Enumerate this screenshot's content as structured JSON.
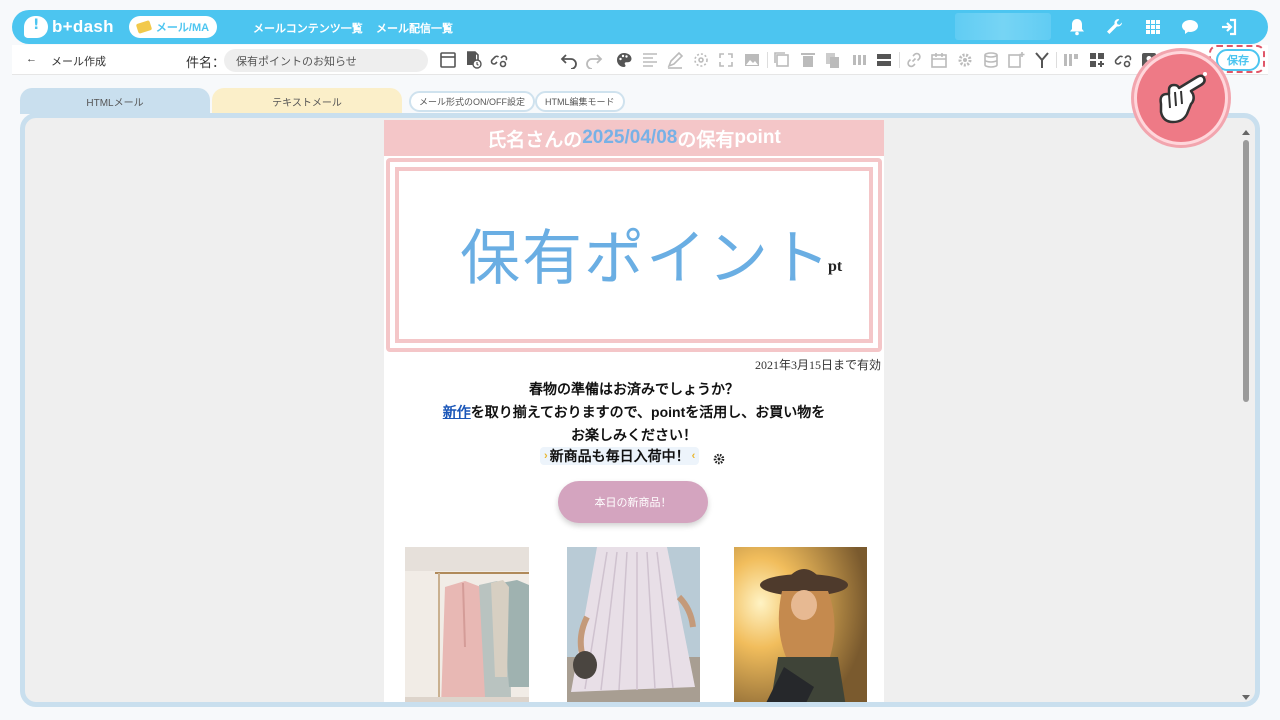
{
  "app": {
    "logo_text": "b+dash",
    "nav_pill": "メール/MA",
    "nav_links": [
      "メールコンテンツ一覧",
      "メール配信一覧"
    ],
    "accent_color": "#4cc5f0"
  },
  "subbar": {
    "back_label": "←",
    "page_title": "メール作成",
    "subject_label": "件名：",
    "subject_value": "保有ポイントのお知らせ",
    "save_label": "保存"
  },
  "tabs": {
    "html_mail": "HTMLメール",
    "text_mail": "テキストメール",
    "format_toggle": "メール形式のON/OFF設定",
    "html_edit_mode": "HTML編集モード"
  },
  "email": {
    "header_prefix": "氏名さんの",
    "header_date": "2025/04/08",
    "header_mid": "の保有",
    "header_suffix": "point",
    "points_title": "保有ポイント",
    "points_unit": "pt",
    "valid_until": "2021年3月15日まで有効",
    "line1": "春物の準備はお済みでしょうか？",
    "line2_link": "新作",
    "line2_rest": "を取り揃えておりますので、pointを活用し、お買い物を",
    "line3": "お楽しみください！",
    "line4": "新商品も毎日入荷中！",
    "cta_label": "本日の新商品！",
    "header_color": "#f4c6c8",
    "highlight_color": "#78b1e6",
    "cta_color": "#d4a4bf"
  },
  "icons": {
    "top": [
      "bell-icon",
      "wrench-icon",
      "grid-icon",
      "chat-icon",
      "logout-icon"
    ],
    "toolbar": [
      "preview-icon",
      "schedule-icon",
      "link-check-icon",
      "undo-icon",
      "redo-icon",
      "palette-icon",
      "align-icon",
      "pen-icon",
      "target-icon",
      "fullscreen-icon",
      "image-icon",
      "copy-icon",
      "delete-icon",
      "duplicate-icon",
      "columns-icon",
      "block-icon",
      "link-icon",
      "calendar-icon",
      "settings-icon",
      "database-icon",
      "note-add-icon",
      "branch-icon",
      "layout-icon",
      "add-block-icon",
      "link2-icon",
      "user-card-icon"
    ]
  },
  "products": [
    "coats-on-rack",
    "pleated-skirt",
    "woman-in-hat"
  ]
}
